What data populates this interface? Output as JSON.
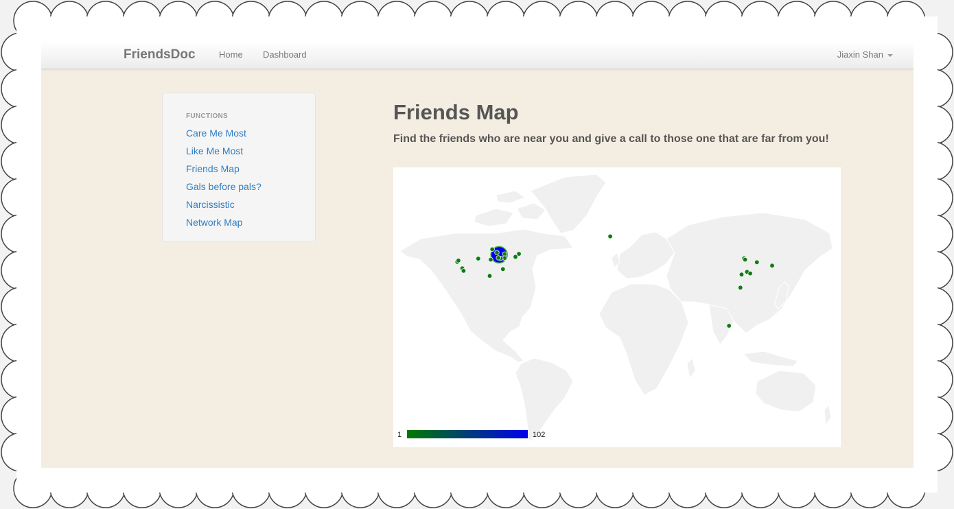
{
  "navbar": {
    "brand": "FriendsDoc",
    "links": [
      "Home",
      "Dashboard"
    ],
    "user": "Jiaxin Shan"
  },
  "sidebar": {
    "header": "FUNCTIONS",
    "items": [
      "Care Me Most",
      "Like Me Most",
      "Friends Map",
      "Gals before pals?",
      "Narcissistic",
      "Network Map"
    ]
  },
  "main": {
    "title": "Friends Map",
    "subtitle": "Find the friends who are near you and give a call to those one that are far from you!"
  },
  "map": {
    "legend": {
      "min": "1",
      "max": "102",
      "min_color": "#007a00",
      "max_color": "#0000ee"
    },
    "land_color": "#f0f0f0",
    "marker_color": "#117a11",
    "max_marker_color": "#0000ee",
    "markers": [
      {
        "name": "chicago-area-max",
        "lat": 41.9,
        "lon": -87.6,
        "count": 102
      },
      {
        "name": "michigan",
        "lat": 42.3,
        "lon": -83.0,
        "count": 1
      },
      {
        "name": "ohio",
        "lat": 40.0,
        "lon": -83.0,
        "count": 1
      },
      {
        "name": "indiana",
        "lat": 39.8,
        "lon": -86.2,
        "count": 1
      },
      {
        "name": "illinois-south",
        "lat": 40.1,
        "lon": -88.2,
        "count": 1
      },
      {
        "name": "wisconsin",
        "lat": 43.1,
        "lon": -89.4,
        "count": 1
      },
      {
        "name": "minneapolis",
        "lat": 45.0,
        "lon": -93.3,
        "count": 1
      },
      {
        "name": "san-francisco",
        "lat": 37.8,
        "lon": -122.4,
        "count": 1
      },
      {
        "name": "sacramento",
        "lat": 38.6,
        "lon": -121.5,
        "count": 1
      },
      {
        "name": "los-angeles",
        "lat": 34.1,
        "lon": -118.2,
        "count": 1
      },
      {
        "name": "san-diego",
        "lat": 32.7,
        "lon": -117.2,
        "count": 1
      },
      {
        "name": "denver",
        "lat": 39.7,
        "lon": -105.0,
        "count": 1
      },
      {
        "name": "kansas",
        "lat": 39.1,
        "lon": -94.6,
        "count": 1
      },
      {
        "name": "texas",
        "lat": 29.8,
        "lon": -95.4,
        "count": 1
      },
      {
        "name": "atlanta",
        "lat": 33.7,
        "lon": -84.4,
        "count": 1
      },
      {
        "name": "new-york",
        "lat": 40.7,
        "lon": -74.0,
        "count": 1
      },
      {
        "name": "boston",
        "lat": 42.4,
        "lon": -71.1,
        "count": 1
      },
      {
        "name": "amsterdam",
        "lat": 52.4,
        "lon": 4.9,
        "count": 1
      },
      {
        "name": "beijing",
        "lat": 39.9,
        "lon": 116.4,
        "count": 1
      },
      {
        "name": "tianjin",
        "lat": 39.1,
        "lon": 117.2,
        "count": 1
      },
      {
        "name": "seoul",
        "lat": 37.6,
        "lon": 127.0,
        "count": 1
      },
      {
        "name": "tokyo",
        "lat": 35.7,
        "lon": 139.7,
        "count": 1
      },
      {
        "name": "nanjing",
        "lat": 32.1,
        "lon": 118.8,
        "count": 1
      },
      {
        "name": "shanghai",
        "lat": 31.2,
        "lon": 121.5,
        "count": 1
      },
      {
        "name": "wuhan",
        "lat": 30.6,
        "lon": 114.3,
        "count": 1
      },
      {
        "name": "guangzhou",
        "lat": 23.1,
        "lon": 113.3,
        "count": 1
      },
      {
        "name": "singapore",
        "lat": 1.3,
        "lon": 103.8,
        "count": 1
      }
    ]
  }
}
